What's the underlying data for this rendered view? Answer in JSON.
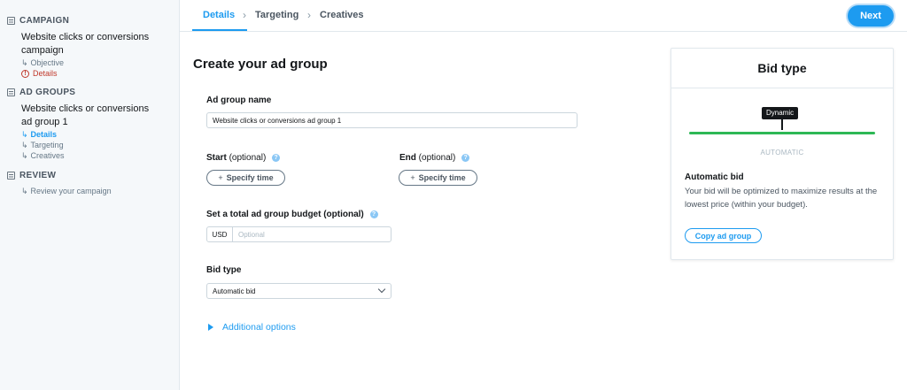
{
  "sidebar": {
    "campaign_header": "CAMPAIGN",
    "campaign_title": "Website clicks or conversions campaign",
    "campaign_items": [
      {
        "label": "Objective"
      },
      {
        "label": "Details"
      }
    ],
    "ad_groups_header": "AD GROUPS",
    "ad_group_title": "Website clicks or conversions ad group 1",
    "ad_group_items": [
      {
        "label": "Details"
      },
      {
        "label": "Targeting"
      },
      {
        "label": "Creatives"
      }
    ],
    "review_header": "REVIEW",
    "review_items": [
      {
        "label": "Review your campaign"
      }
    ]
  },
  "tabs": [
    {
      "label": "Details",
      "active": true
    },
    {
      "label": "Targeting"
    },
    {
      "label": "Creatives"
    }
  ],
  "next_label": "Next",
  "form": {
    "title": "Create your ad group",
    "name_label": "Ad group name",
    "name_value": "Website clicks or conversions ad group 1",
    "start_label": "Start",
    "end_label": "End",
    "optional_text": "(optional)",
    "specify_time": "Specify time",
    "budget_label": "Set a total ad group budget (optional)",
    "currency": "USD",
    "budget_placeholder": "Optional",
    "bid_type_label": "Bid type",
    "bid_type_value": "Automatic bid",
    "additional_options": "Additional options"
  },
  "bid_card": {
    "title": "Bid type",
    "tooltip": "Dynamic",
    "caption": "AUTOMATIC",
    "heading": "Automatic bid",
    "description": "Your bid will be optimized to maximize results at the lowest price (within your budget).",
    "copy_button": "Copy ad group"
  },
  "colors": {
    "accent": "#1d9bf0",
    "slider": "#2eb855",
    "alert": "#c0392b"
  }
}
